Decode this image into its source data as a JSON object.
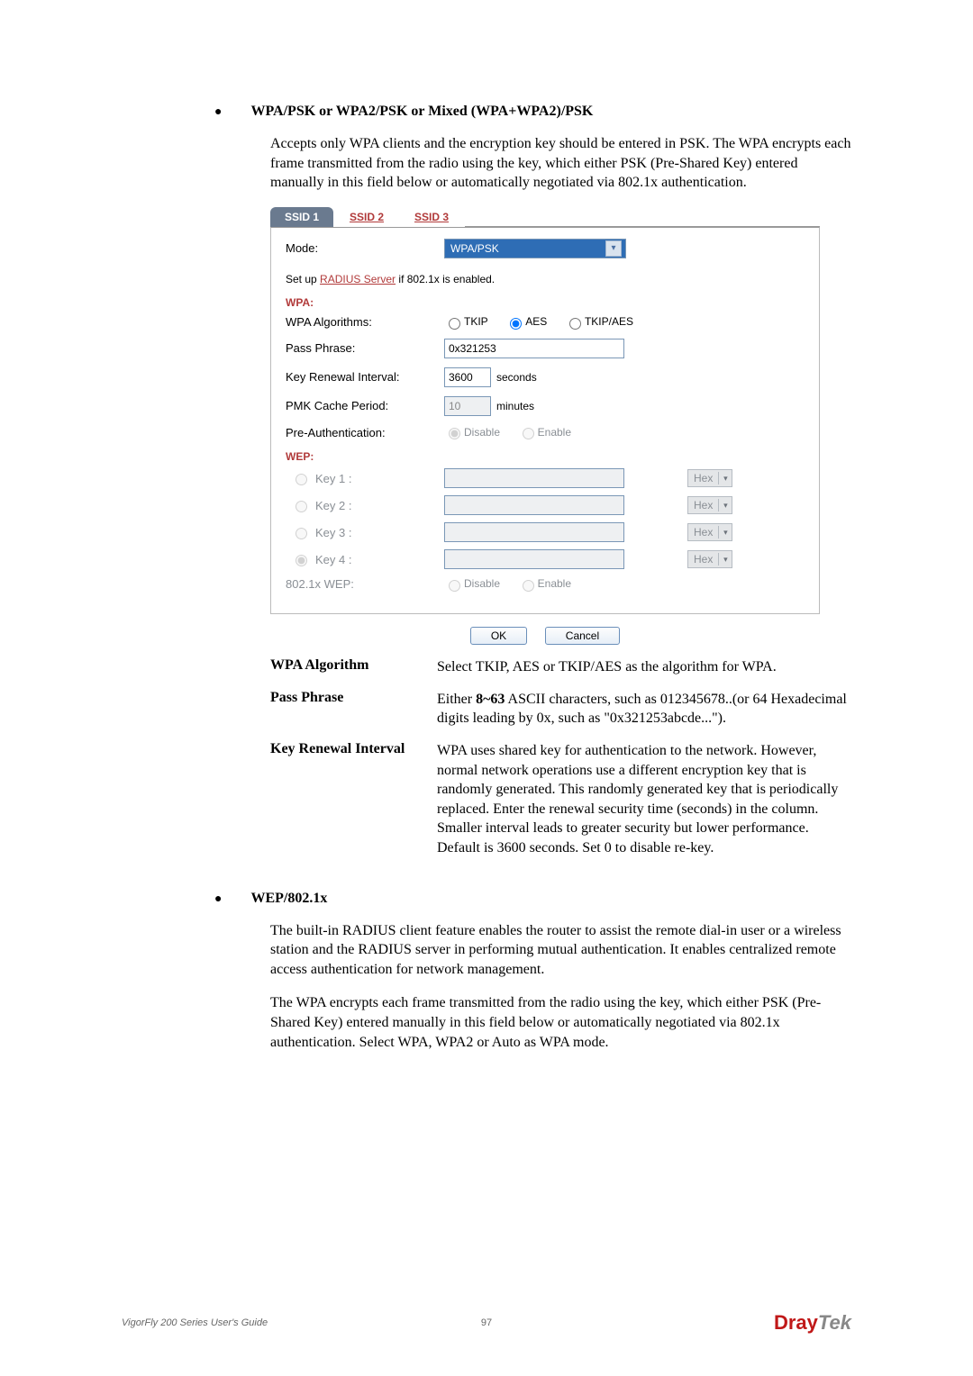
{
  "headings": {
    "wpa_psk": "WPA/PSK or WPA2/PSK or Mixed (WPA+WPA2)/PSK",
    "wep_8021x": "WEP/802.1x"
  },
  "paragraphs": {
    "wpa_psk_intro": "Accepts only WPA clients and the encryption key should be entered in PSK. The WPA encrypts each frame transmitted from the radio using the key, which either PSK (Pre-Shared Key) entered manually in this field below or automatically negotiated via 802.1x authentication.",
    "wep_para1": "The built-in RADIUS client feature enables the router to assist the remote dial-in user or a wireless station and the RADIUS server in performing mutual authentication. It enables centralized remote access authentication for network management.",
    "wep_para2": "The WPA encrypts each frame transmitted from the radio using the key, which either PSK (Pre-Shared Key) entered manually in this field below or automatically negotiated via 802.1x authentication. Select WPA, WPA2 or Auto as WPA mode."
  },
  "shot": {
    "tabs": {
      "ssid1": "SSID 1",
      "ssid2": "SSID 2",
      "ssid3": "SSID 3"
    },
    "mode_label": "Mode:",
    "mode_value": "WPA/PSK",
    "radius_pre": "Set up ",
    "radius_link": "RADIUS Server",
    "radius_post": " if 802.1x is enabled.",
    "wpa_section": "WPA:",
    "wep_section": "WEP:",
    "labels": {
      "wpa_algorithms": "WPA Algorithms:",
      "pass_phrase": "Pass Phrase:",
      "key_renewal": "Key Renewal Interval:",
      "pmk_cache": "PMK Cache Period:",
      "pre_auth": "Pre-Authentication:",
      "8021x_wep": "802.1x WEP:"
    },
    "opts": {
      "tkip": "TKIP",
      "aes": "AES",
      "tkip_aes": "TKIP/AES",
      "disable": "Disable",
      "enable": "Enable"
    },
    "values": {
      "pass_phrase": "0x321253",
      "key_renewal": "3600",
      "key_renewal_units": "seconds",
      "pmk_cache": "10",
      "pmk_cache_units": "minutes"
    },
    "keys": {
      "k1": "Key 1 :",
      "k2": "Key 2 :",
      "k3": "Key 3 :",
      "k4": "Key 4 :",
      "hex": "Hex"
    },
    "buttons": {
      "ok": "OK",
      "cancel": "Cancel"
    }
  },
  "defs": {
    "wpa_algorithm": {
      "term": "WPA Algorithm",
      "desc": "Select TKIP, AES or TKIP/AES as the algorithm for WPA."
    },
    "pass_phrase": {
      "term": "Pass Phrase",
      "desc_pre": "Either ",
      "bold": "8~63",
      "desc_post": " ASCII characters, such as 012345678..(or 64 Hexadecimal digits leading by 0x, such as \"0x321253abcde...\")."
    },
    "key_renewal": {
      "term": "Key Renewal Interval",
      "desc": "WPA uses shared key for authentication to the network. However, normal network operations use a different encryption key that is randomly generated. This randomly generated key that is periodically replaced. Enter the renewal security time (seconds) in the column. Smaller interval leads to greater security but lower performance. Default is 3600 seconds. Set 0 to disable re-key."
    }
  },
  "footer": {
    "left": "VigorFly 200 Series User's Guide",
    "page": "97",
    "brand_d": "Dray",
    "brand_tek": "Tek"
  }
}
